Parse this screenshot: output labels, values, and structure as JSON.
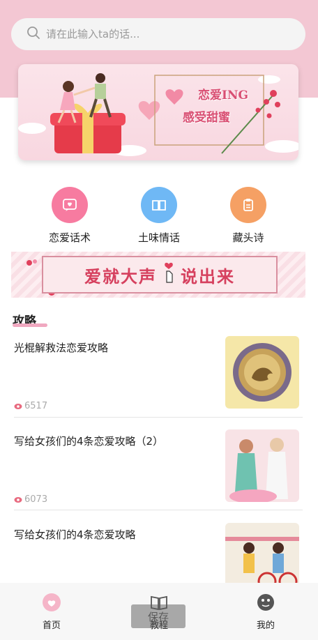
{
  "search": {
    "placeholder": "请在此输入ta的话..."
  },
  "banner": {
    "line1": "恋爱ING",
    "line2": "感受甜蜜"
  },
  "categories": [
    {
      "label": "恋爱话术",
      "color": "#f77ba0",
      "icon": "heart-chat-icon"
    },
    {
      "label": "土味情话",
      "color": "#6fb8f5",
      "icon": "book-icon"
    },
    {
      "label": "藏头诗",
      "color": "#f5a064",
      "icon": "scroll-icon"
    }
  ],
  "slogan_banner": {
    "text_left": "爱就大声",
    "text_right": "说出来"
  },
  "section": {
    "title": "攻略"
  },
  "articles": [
    {
      "title": "光棍解救法恋爱攻略",
      "views": "6517"
    },
    {
      "title": "写给女孩们的4条恋爱攻略（2）",
      "views": "6073"
    },
    {
      "title": "写给女孩们的4条恋爱攻略",
      "views": ""
    }
  ],
  "tabs": [
    {
      "label": "首页",
      "icon": "home-heart-icon",
      "active": true
    },
    {
      "label": "教程",
      "icon": "book-open-icon",
      "active": false
    },
    {
      "label": "我的",
      "icon": "profile-icon",
      "active": false
    }
  ],
  "toast": {
    "text": "保存"
  },
  "colors": {
    "accent_pink": "#f3c7d3",
    "brand_red": "#d6405e",
    "views_icon": "#e86a7f"
  }
}
